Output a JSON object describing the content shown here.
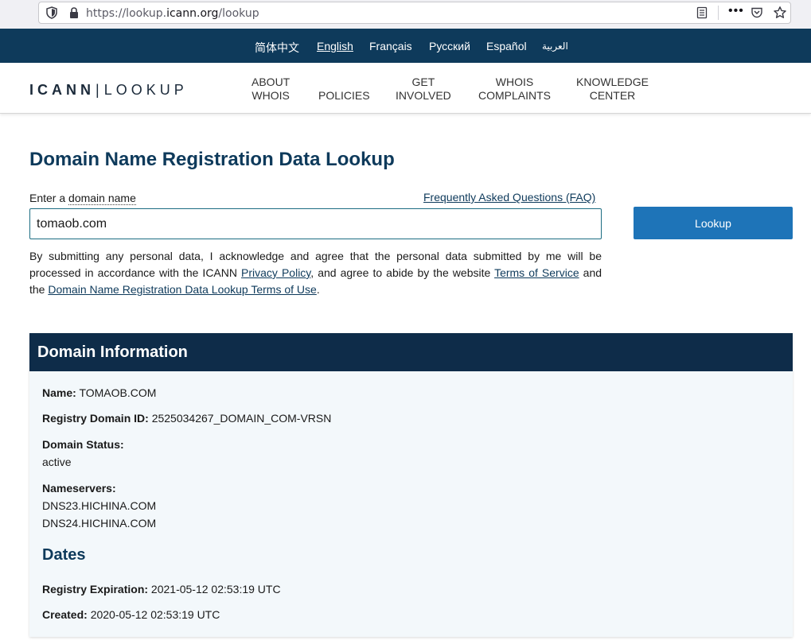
{
  "browser": {
    "url_prefix": "https://lookup.",
    "url_domain": "icann.org",
    "url_path": "/lookup",
    "more_glyph": "•••"
  },
  "languages": [
    {
      "label": "简体中文",
      "active": false
    },
    {
      "label": "English",
      "active": true
    },
    {
      "label": "Français",
      "active": false
    },
    {
      "label": "Русский",
      "active": false
    },
    {
      "label": "Español",
      "active": false
    },
    {
      "label": "العربية",
      "active": false
    }
  ],
  "header": {
    "logo_left": "ICANN",
    "logo_sep": "|",
    "logo_right": "LOOKUP",
    "nav": [
      {
        "line1": "ABOUT",
        "line2": "WHOIS"
      },
      {
        "line1": "",
        "line2": "POLICIES"
      },
      {
        "line1": "GET",
        "line2": "INVOLVED"
      },
      {
        "line1": "WHOIS",
        "line2": "COMPLAINTS"
      },
      {
        "line1": "KNOWLEDGE",
        "line2": "CENTER"
      }
    ]
  },
  "main": {
    "title": "Domain Name Registration Data Lookup",
    "label_prefix": "Enter a ",
    "label_link": "domain name",
    "faq": "Frequently Asked Questions (FAQ)",
    "input_value": "tomaob.com",
    "lookup_label": "Lookup",
    "disclaimer": {
      "part1": "By submitting any personal data, I acknowledge and agree that the personal data submitted by me will be processed in accordance with the ICANN ",
      "privacy": "Privacy Policy",
      "part2": ", and agree to abide by the website ",
      "terms": "Terms of Service",
      "part3": " and the ",
      "lookup_terms": "Domain Name Registration Data Lookup Terms of Use",
      "part4": "."
    }
  },
  "result": {
    "panel_title": "Domain Information",
    "name_key": "Name:",
    "name_value": "TOMAOB.COM",
    "registry_id_key": "Registry Domain ID:",
    "registry_id_value": "2525034267_DOMAIN_COM-VRSN",
    "status_key": "Domain Status:",
    "status_value": "active",
    "nameservers_key": "Nameservers:",
    "nameservers": [
      "DNS23.HICHINA.COM",
      "DNS24.HICHINA.COM"
    ],
    "dates_title": "Dates",
    "expiration_key": "Registry Expiration:",
    "expiration_value": "2021-05-12 02:53:19 UTC",
    "created_key": "Created:",
    "created_value": "2020-05-12 02:53:19 UTC"
  },
  "colors": {
    "brand_navy": "#0e3a5b",
    "panel_header": "#0e2c49",
    "button_blue": "#1e74b8",
    "panel_bg": "#f3f8fb"
  },
  "icons": [
    "shield-icon",
    "lock-icon",
    "reader-view-icon",
    "more-icon",
    "pocket-icon",
    "bookmark-star-icon"
  ]
}
